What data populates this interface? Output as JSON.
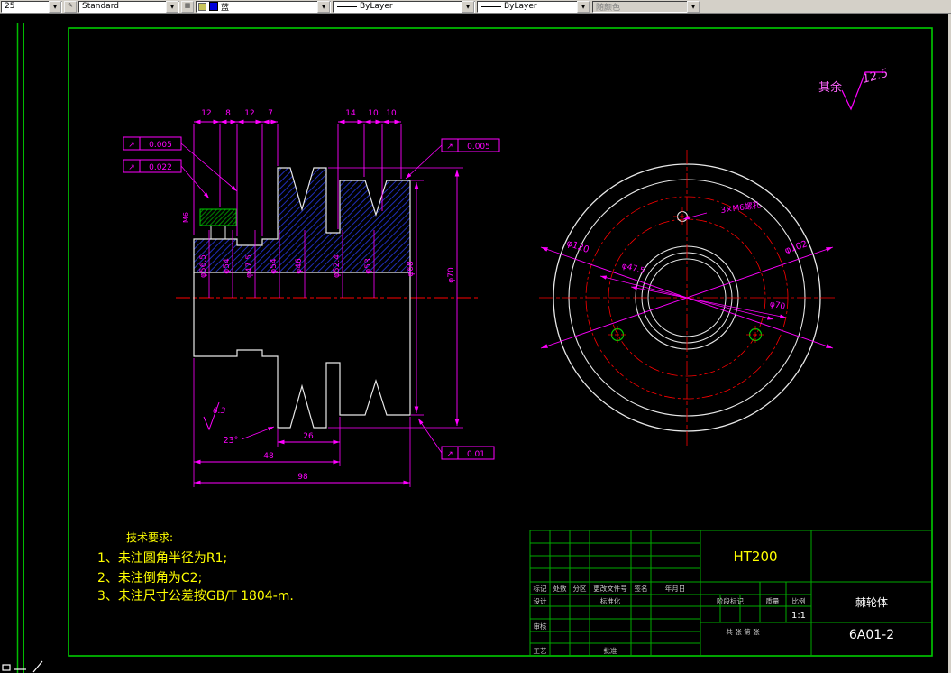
{
  "toolbar": {
    "combo_dim": "25",
    "combo_style": "Standard",
    "combo_layer": "蓝",
    "combo_linetype": "ByLayer",
    "combo_lineweight": "ByLayer",
    "combo_plotstyle": "随颜色",
    "dropdown_glyph": "▼"
  },
  "annotations": {
    "general_finish_prefix": "其余",
    "general_finish_value": "12.5",
    "finish_value": "6.3",
    "angle": "23°",
    "key_thread": "M6",
    "holes_note": "3×M6螺孔"
  },
  "dims": {
    "top": [
      "12",
      "8",
      "12",
      "7",
      "14",
      "10",
      "10"
    ],
    "diameters": [
      "φ56.5",
      "φ54",
      "φ47.5",
      "φ54",
      "φ46",
      "φ52.4",
      "φ53"
    ],
    "dia68": "φ68",
    "dia70": "φ70",
    "bottom26": "26",
    "bottom48": "48",
    "bottom98": "98",
    "circ120": "φ120",
    "circ102": "φ102",
    "circ47": "φ47.5",
    "circ70": "φ70"
  },
  "tolerances": [
    {
      "sym": "↗",
      "val": "0.005"
    },
    {
      "sym": "↗",
      "val": "0.022"
    },
    {
      "sym": "↗",
      "val": "0.005"
    },
    {
      "sym": "↗",
      "val": "0.01"
    }
  ],
  "tech_req": {
    "title": "技术要求:",
    "items": [
      "1、未注圆角半径为R1;",
      "2、未注倒角为C2;",
      "3、未注尺寸公差按GB/T 1804-m."
    ]
  },
  "title_block": {
    "material": "HT200",
    "part_name": "棘轮体",
    "drawing_no": "6A01-2",
    "scale": "1:1",
    "headers": {
      "mark": "标记",
      "count": "处数",
      "zone": "分区",
      "doc_no": "更改文件号",
      "sign": "签名",
      "date": "年月日"
    },
    "roles": {
      "design": "设计",
      "standardize": "标准化",
      "check": "审核",
      "process": "工艺",
      "approve": "批准"
    },
    "fields": {
      "stage": "阶段标记",
      "weight": "质量",
      "scale_label": "比例",
      "sheet": "共 张 第 张"
    }
  }
}
